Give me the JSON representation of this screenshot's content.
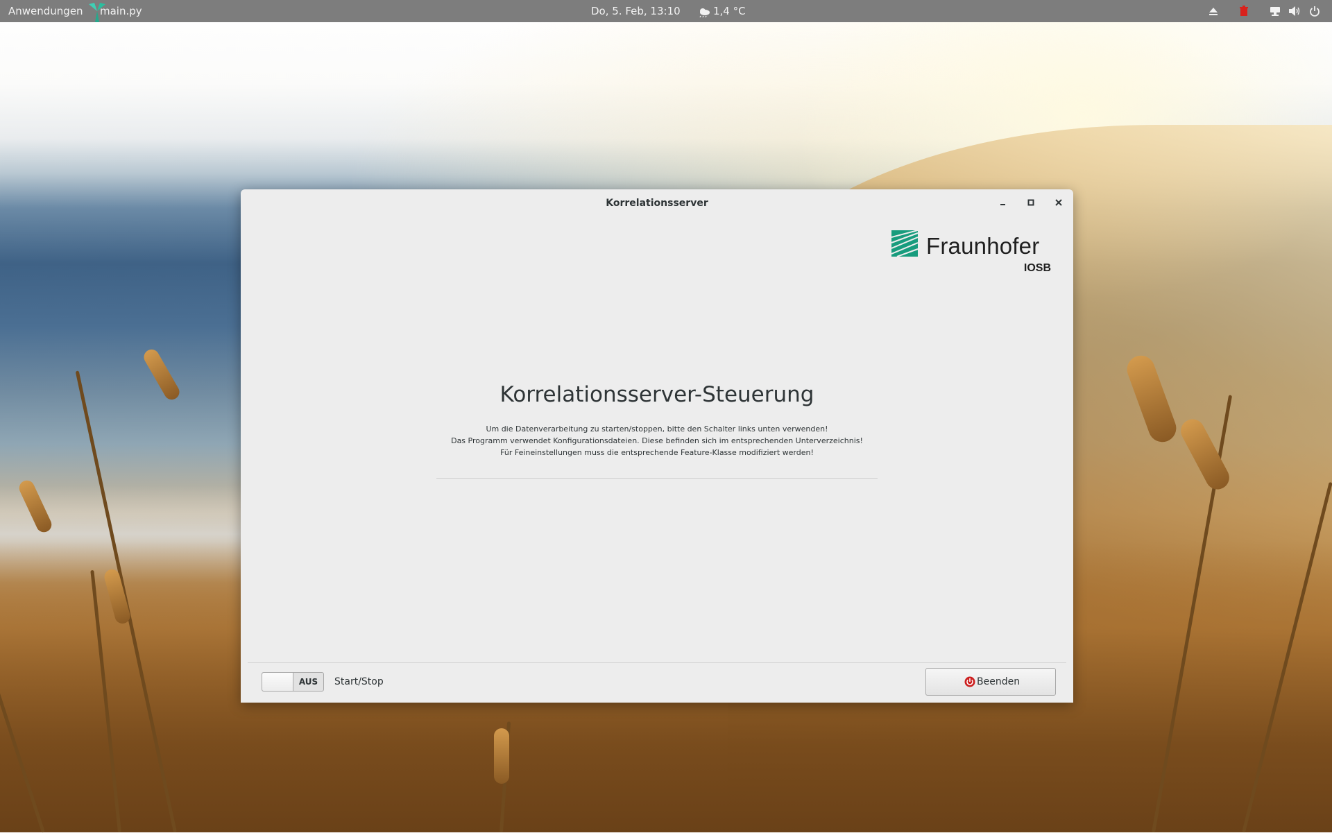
{
  "topbar": {
    "applications_label": "Anwendungen",
    "active_app": "main.py",
    "clock": "Do,  5. Feb, 13:10",
    "weather_temp": "1,4 °C",
    "tray_icons": [
      "eject-icon",
      "trash-icon",
      "network-icon",
      "volume-icon",
      "power-icon"
    ]
  },
  "window": {
    "title": "Korrelationsserver",
    "controls": [
      "minimize-icon",
      "maximize-icon",
      "close-icon"
    ],
    "logo": {
      "name": "Fraunhofer",
      "sub": "IOSB",
      "color": "#179c7d"
    },
    "heading": "Korrelationsserver-Steuerung",
    "description": [
      "Um die Datenverarbeitung zu starten/stoppen, bitte den Schalter links unten verwenden!",
      "Das Programm verwendet Konfigurationsdateien. Diese befinden sich im entsprechenden Unterverzeichnis!",
      "Für Feineinstellungen muss die entsprechende Feature-Klasse modifiziert werden!"
    ],
    "switch": {
      "state": "AUS",
      "label": "Start/Stop"
    },
    "quit_button": "Beenden"
  }
}
